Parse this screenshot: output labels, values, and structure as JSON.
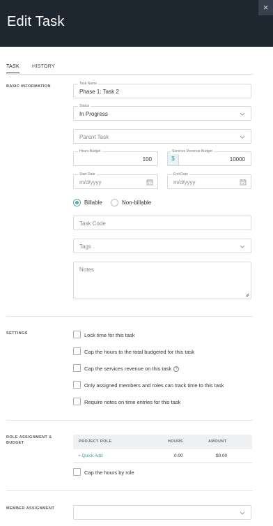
{
  "header": {
    "title": "Edit Task",
    "close_label": "×"
  },
  "tabs": [
    {
      "label": "TASK"
    },
    {
      "label": "HISTORY"
    }
  ],
  "sections": {
    "basic": "BASIC INFORMATION",
    "settings": "SETTINGS",
    "role": "ROLE ASSIGNMENT & BUDGET",
    "member": "MEMBER ASSIGNMENT"
  },
  "form": {
    "task_name": {
      "label": "Task Name",
      "value": "Phase 1: Task 2"
    },
    "status": {
      "label": "Status",
      "value": "In Progress"
    },
    "parent_task": {
      "placeholder": "Parent Task"
    },
    "hours_budget": {
      "label": "Hours Budget",
      "value": "100"
    },
    "revenue_budget": {
      "label": "Services Revenue Budget",
      "prefix": "$",
      "value": "10000"
    },
    "start_date": {
      "label": "Start Date",
      "placeholder": "m/d/yyyy"
    },
    "end_date": {
      "label": "End Date",
      "placeholder": "m/d/yyyy"
    },
    "billing": {
      "options": [
        "Billable",
        "Non-billable"
      ],
      "selected": "Billable"
    },
    "task_code": {
      "placeholder": "Task Code"
    },
    "tags": {
      "placeholder": "Tags"
    },
    "notes": {
      "placeholder": "Notes"
    }
  },
  "settings": [
    {
      "label": "Lock time for this task",
      "checked": false
    },
    {
      "label": "Cap the hours to the total budgeted for this task",
      "checked": false
    },
    {
      "label": "Cap the services revenue on this task",
      "checked": false,
      "info": "?"
    },
    {
      "label": "Only assigned members and roles can track time to this task",
      "checked": false
    },
    {
      "label": "Require notes on time entries for this task",
      "checked": false
    }
  ],
  "role_table": {
    "headers": {
      "role": "PROJECT ROLE",
      "hours": "HOURS",
      "amount": "AMOUNT"
    },
    "row": {
      "quick_add": "+ Quick Add",
      "hours": "0.00",
      "amount": "$0.00"
    },
    "cap_label": "Cap the hours by role"
  },
  "colors": {
    "header_bg": "#1e2630",
    "accent": "#5aaab3"
  }
}
